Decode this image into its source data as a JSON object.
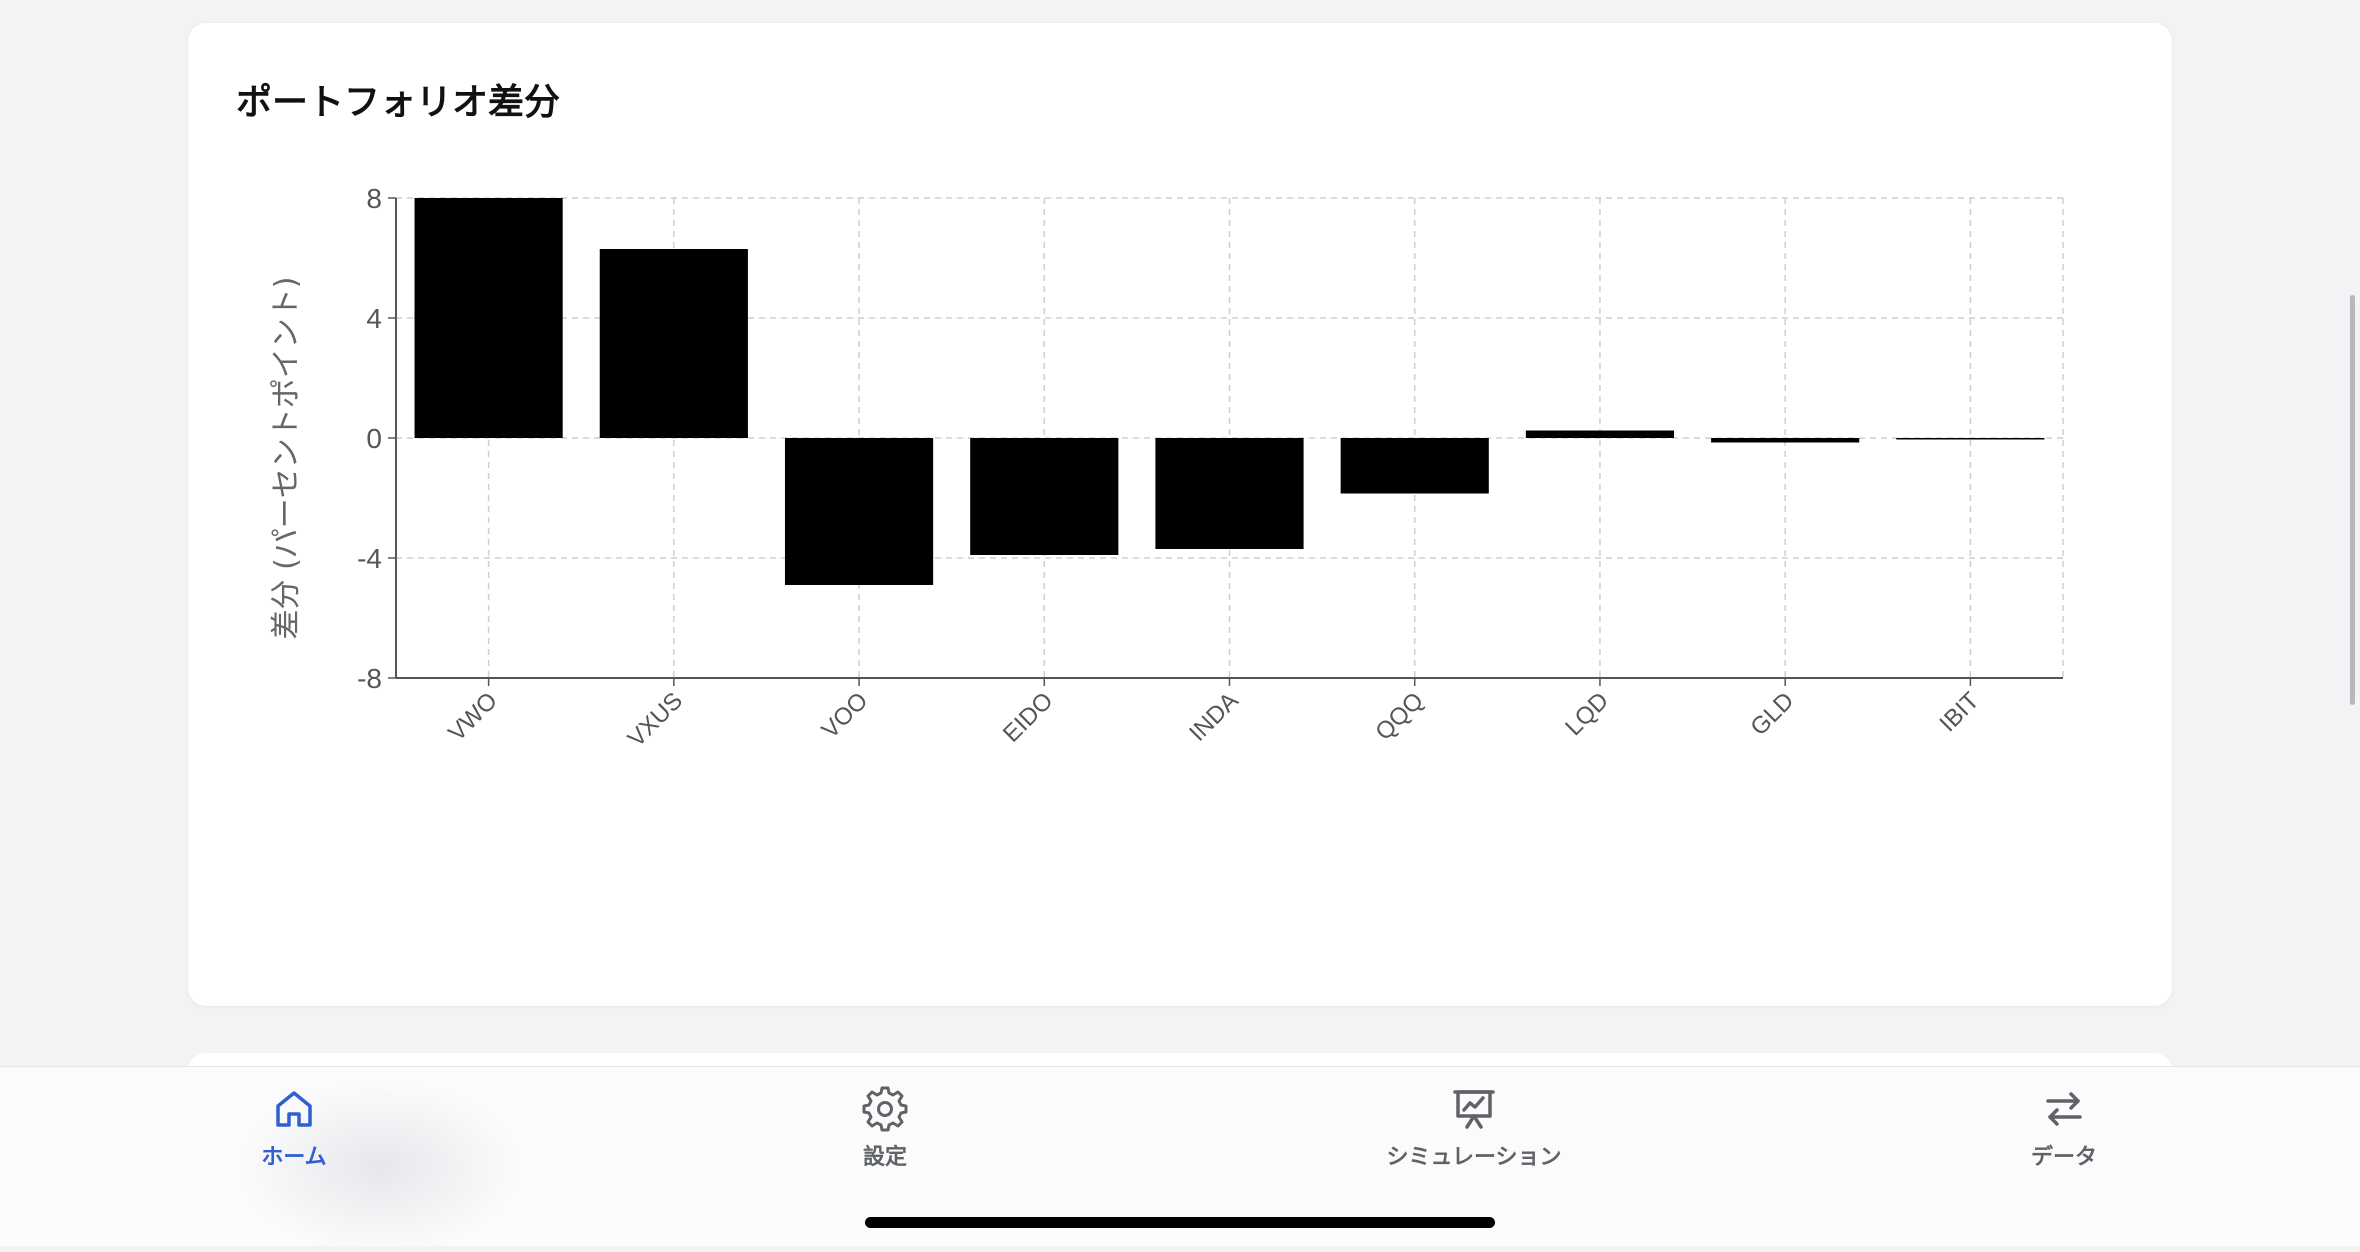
{
  "card": {
    "title": "ポートフォリオ差分"
  },
  "chart_data": {
    "type": "bar",
    "title": "ポートフォリオ差分",
    "xlabel": "",
    "ylabel": "差分 (パーセントポイント)",
    "categories": [
      "VWO",
      "VXUS",
      "VOO",
      "EIDO",
      "INDA",
      "QQQ",
      "LQD",
      "GLD",
      "IBIT"
    ],
    "values": [
      8.0,
      6.3,
      -4.9,
      -3.9,
      -3.7,
      -1.85,
      0.25,
      -0.15,
      -0.03
    ],
    "ylim": [
      -8,
      8
    ],
    "yticks": [
      8,
      4,
      0,
      -4,
      -8
    ],
    "grid": true,
    "bar_color": "#000000"
  },
  "tabbar": {
    "accent_color": "#2f5fd0",
    "inactive_color": "#5f6368",
    "items": [
      {
        "label": "ホーム",
        "icon": "home-icon",
        "active": true
      },
      {
        "label": "設定",
        "icon": "gear-icon",
        "active": false
      },
      {
        "label": "シミュレーション",
        "icon": "presentation-chart-icon",
        "active": false
      },
      {
        "label": "データ",
        "icon": "arrows-swap-icon",
        "active": false
      }
    ]
  }
}
